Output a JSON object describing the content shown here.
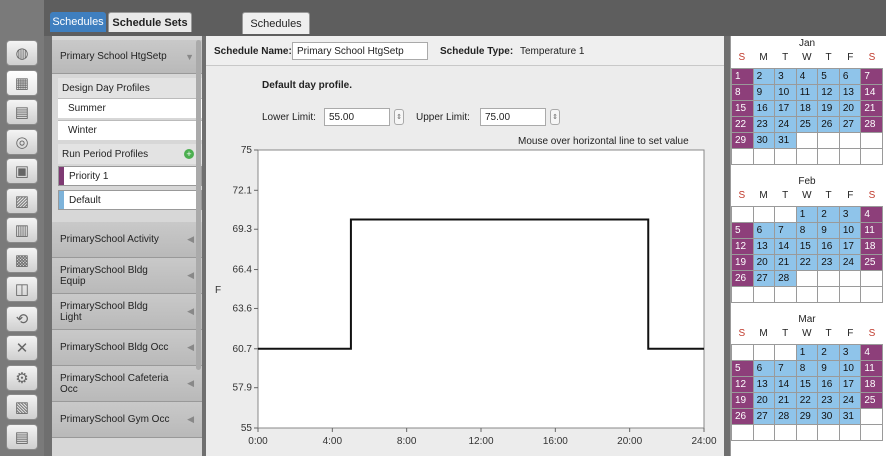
{
  "tabs": {
    "left_active": "Schedules",
    "left_other": "Schedule Sets",
    "main": "Schedules"
  },
  "rail_icons": [
    "globe-icon",
    "calendar-icon",
    "building-icon",
    "constructions-icon",
    "loads-icon",
    "space-types-icon",
    "geometry-icon",
    "facility-icon",
    "spaces-icon",
    "thermal-zones-icon",
    "hvac-icon",
    "output-variables-icon",
    "simulation-settings-icon",
    "scripts-icon"
  ],
  "list": {
    "selected_schedule": "Primary School HtgSetp",
    "design_day_profiles": "Design Day Profiles",
    "summer": "Summer",
    "winter": "Winter",
    "run_period_profiles": "Run Period Profiles",
    "priority": "Priority 1",
    "default": "Default",
    "priority_color": "#7e3a73",
    "default_color": "#7db3da",
    "others": [
      "PrimarySchool Activity",
      "PrimarySchool Bldg Equip",
      "PrimarySchool Bldg Light",
      "PrimarySchool Bldg Occ",
      "PrimarySchool Cafeteria Occ",
      "PrimarySchool Gym Occ"
    ]
  },
  "editor": {
    "schedule_name_label": "Schedule Name:",
    "schedule_name_value": "Primary School HtgSetp",
    "schedule_type_label": "Schedule Type:",
    "schedule_type_value": "Temperature 1",
    "profile_title": "Default day profile.",
    "lower_limit_label": "Lower Limit:",
    "lower_limit_value": "55.00",
    "upper_limit_label": "Upper Limit:",
    "upper_limit_value": "75.00",
    "hint": "Mouse over horizontal line to set value"
  },
  "chart_data": {
    "type": "line",
    "ylabel": "F",
    "xlabel": "",
    "ylim": [
      55,
      75
    ],
    "xlim": [
      0,
      24
    ],
    "x_ticks": [
      "0:00",
      "4:00",
      "8:00",
      "12:00",
      "16:00",
      "20:00",
      "24:00"
    ],
    "y_ticks": [
      "55",
      "57.9",
      "60.7",
      "63.6",
      "66.4",
      "69.3",
      "72.1",
      "75"
    ],
    "series": [
      {
        "x": [
          0,
          5,
          5,
          21,
          21,
          24
        ],
        "values": [
          60.7,
          60.7,
          70,
          70,
          60.7,
          60.7
        ]
      }
    ]
  },
  "calendar": {
    "dow": [
      "S",
      "M",
      "T",
      "W",
      "T",
      "F",
      "S"
    ],
    "months": [
      {
        "name": "Jan",
        "start": 0,
        "days": 31
      },
      {
        "name": "Feb",
        "start": 3,
        "days": 28
      },
      {
        "name": "Mar",
        "start": 3,
        "days": 31
      }
    ],
    "weekday_color": "#8fc4ea",
    "weekend_color": "#8d3f7a"
  }
}
